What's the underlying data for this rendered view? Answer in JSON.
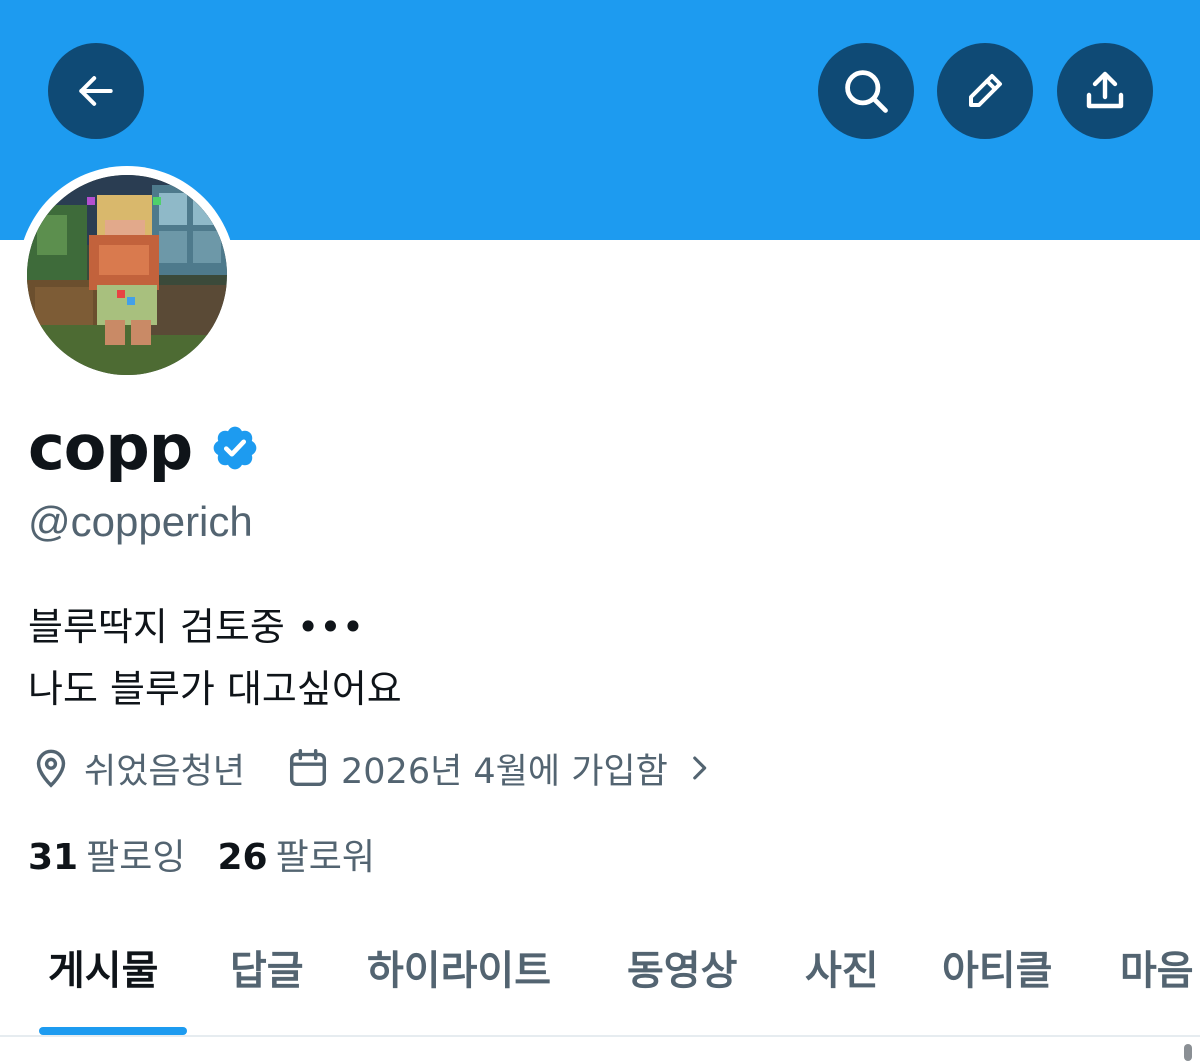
{
  "header": {
    "banner_color": "#1d9bf0",
    "button_color": "#0f4a75",
    "buttons": [
      {
        "icon": "back-arrow-icon"
      },
      {
        "icon": "search-icon"
      },
      {
        "icon": "pencil-icon"
      },
      {
        "icon": "share-icon"
      }
    ]
  },
  "profile": {
    "display_name": "copp",
    "verified_icon": "verified-badge-icon",
    "verified_color": "#1d9bf0",
    "handle": "@copperich",
    "bio_line1": "블루딱지 검토중 •••",
    "bio_line2": "나도 블루가 대고싶어요",
    "location": "쉬었음청년",
    "joined": "2026년 4월에 가입함",
    "following_count": "31",
    "following_label": "팔로잉",
    "followers_count": "26",
    "followers_label": "팔로워"
  },
  "tabs": [
    {
      "label": "게시물",
      "active": true
    },
    {
      "label": "답글",
      "active": false
    },
    {
      "label": "하이라이트",
      "active": false
    },
    {
      "label": "동영상",
      "active": false
    },
    {
      "label": "사진",
      "active": false
    },
    {
      "label": "아티클",
      "active": false
    },
    {
      "label": "마음",
      "active": false
    }
  ],
  "accent_color": "#1d9bf0"
}
